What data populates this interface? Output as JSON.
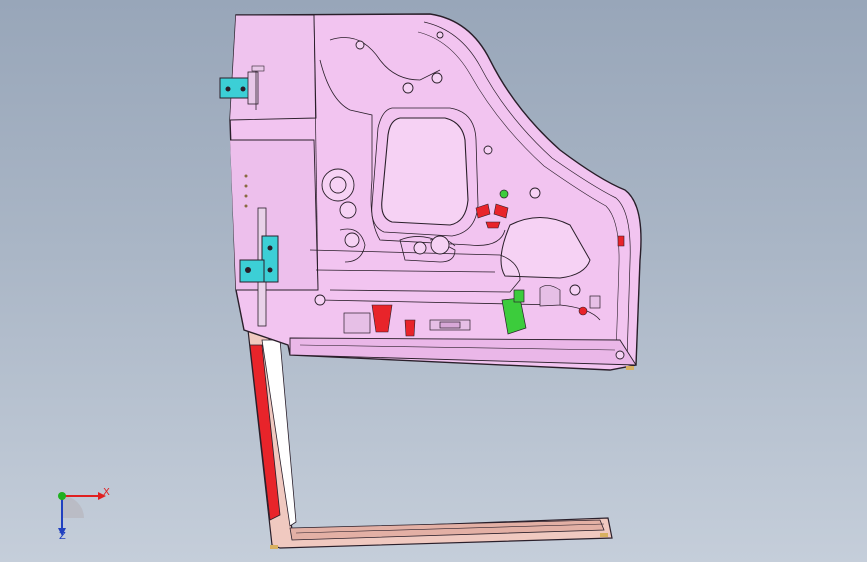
{
  "window": {
    "title": ""
  },
  "viewport": {
    "background_top": "#98a6b9",
    "background_bottom": "#c5ceda",
    "model_color": "#f2c4f0",
    "edge_color": "#2a1f2a",
    "highlight_red": "#e8242a",
    "highlight_green": "#3ccc3c",
    "highlight_cyan": "#3ccfd6",
    "frame_color": "#d8a0a0"
  },
  "triad": {
    "x_label": "X",
    "z_label": "Z",
    "x_color": "#e02020",
    "y_color": "#20b020",
    "z_color": "#2040c0"
  },
  "icons": [
    "coordinate-triad-icon"
  ]
}
